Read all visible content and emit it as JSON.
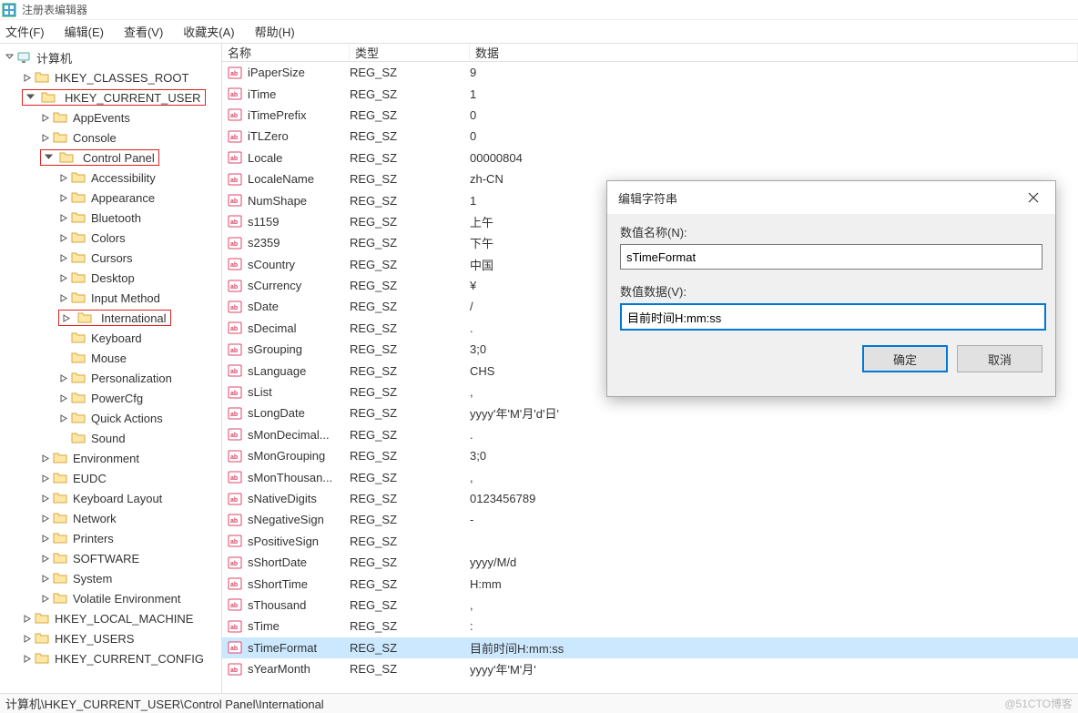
{
  "window": {
    "title": "注册表编辑器"
  },
  "menu": {
    "file": "文件(F)",
    "edit": "编辑(E)",
    "view": "查看(V)",
    "favorites": "收藏夹(A)",
    "help": "帮助(H)"
  },
  "tree": {
    "root": "计算机",
    "hives": {
      "classes_root": "HKEY_CLASSES_ROOT",
      "current_user": "HKEY_CURRENT_USER",
      "local_machine": "HKEY_LOCAL_MACHINE",
      "users": "HKEY_USERS",
      "current_config": "HKEY_CURRENT_CONFIG"
    },
    "hkcu_children": [
      "AppEvents",
      "Console",
      "Control Panel",
      "Environment",
      "EUDC",
      "Keyboard Layout",
      "Network",
      "Printers",
      "SOFTWARE",
      "System",
      "Volatile Environment"
    ],
    "cp_children": [
      "Accessibility",
      "Appearance",
      "Bluetooth",
      "Colors",
      "Cursors",
      "Desktop",
      "Input Method",
      "International",
      "Keyboard",
      "Mouse",
      "Personalization",
      "PowerCfg",
      "Quick Actions",
      "Sound"
    ]
  },
  "list": {
    "hdr": {
      "name": "名称",
      "type": "类型",
      "data": "数据"
    },
    "rows": [
      {
        "n": "iPaperSize",
        "t": "REG_SZ",
        "d": "9"
      },
      {
        "n": "iTime",
        "t": "REG_SZ",
        "d": "1"
      },
      {
        "n": "iTimePrefix",
        "t": "REG_SZ",
        "d": "0"
      },
      {
        "n": "iTLZero",
        "t": "REG_SZ",
        "d": "0"
      },
      {
        "n": "Locale",
        "t": "REG_SZ",
        "d": "00000804"
      },
      {
        "n": "LocaleName",
        "t": "REG_SZ",
        "d": "zh-CN"
      },
      {
        "n": "NumShape",
        "t": "REG_SZ",
        "d": "1"
      },
      {
        "n": "s1159",
        "t": "REG_SZ",
        "d": "上午"
      },
      {
        "n": "s2359",
        "t": "REG_SZ",
        "d": "下午"
      },
      {
        "n": "sCountry",
        "t": "REG_SZ",
        "d": "中国"
      },
      {
        "n": "sCurrency",
        "t": "REG_SZ",
        "d": "¥"
      },
      {
        "n": "sDate",
        "t": "REG_SZ",
        "d": "/"
      },
      {
        "n": "sDecimal",
        "t": "REG_SZ",
        "d": "."
      },
      {
        "n": "sGrouping",
        "t": "REG_SZ",
        "d": "3;0"
      },
      {
        "n": "sLanguage",
        "t": "REG_SZ",
        "d": "CHS"
      },
      {
        "n": "sList",
        "t": "REG_SZ",
        "d": ","
      },
      {
        "n": "sLongDate",
        "t": "REG_SZ",
        "d": "yyyy'年'M'月'd'日'"
      },
      {
        "n": "sMonDecimal...",
        "t": "REG_SZ",
        "d": "."
      },
      {
        "n": "sMonGrouping",
        "t": "REG_SZ",
        "d": "3;0"
      },
      {
        "n": "sMonThousan...",
        "t": "REG_SZ",
        "d": ","
      },
      {
        "n": "sNativeDigits",
        "t": "REG_SZ",
        "d": "0123456789"
      },
      {
        "n": "sNegativeSign",
        "t": "REG_SZ",
        "d": "-"
      },
      {
        "n": "sPositiveSign",
        "t": "REG_SZ",
        "d": ""
      },
      {
        "n": "sShortDate",
        "t": "REG_SZ",
        "d": "yyyy/M/d"
      },
      {
        "n": "sShortTime",
        "t": "REG_SZ",
        "d": "H:mm"
      },
      {
        "n": "sThousand",
        "t": "REG_SZ",
        "d": ","
      },
      {
        "n": "sTime",
        "t": "REG_SZ",
        "d": ":"
      },
      {
        "n": "sTimeFormat",
        "t": "REG_SZ",
        "d": "目前时间H:mm:ss",
        "sel": true
      },
      {
        "n": "sYearMonth",
        "t": "REG_SZ",
        "d": "yyyy'年'M'月'"
      }
    ]
  },
  "dialog": {
    "title": "编辑字符串",
    "name_label": "数值名称(N):",
    "name_value": "sTimeFormat",
    "data_label": "数值数据(V):",
    "data_value": "目前时间H:mm:ss",
    "ok": "确定",
    "cancel": "取消"
  },
  "status": {
    "path": "计算机\\HKEY_CURRENT_USER\\Control Panel\\International"
  },
  "watermark": "@51CTO博客"
}
